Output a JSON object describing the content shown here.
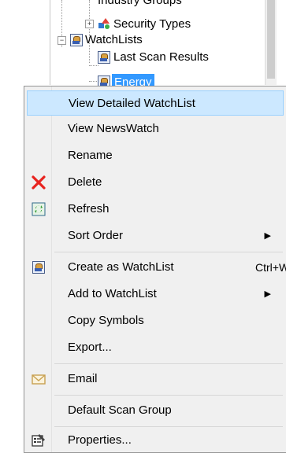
{
  "tree": {
    "items": [
      {
        "label": "Industry Groups"
      },
      {
        "label": "Security Types"
      },
      {
        "label": "WatchLists"
      },
      {
        "label": "Last Scan Results"
      },
      {
        "label": "Energy"
      }
    ]
  },
  "context_menu": {
    "items": [
      {
        "label": "View Detailed WatchList",
        "highlighted": true
      },
      {
        "label": "View NewsWatch"
      },
      {
        "label": "Rename"
      },
      {
        "label": "Delete",
        "icon": "delete-x-icon",
        "icon_color": "#e8231f"
      },
      {
        "label": "Refresh",
        "icon": "refresh-icon",
        "icon_color": "#2f9a2f"
      },
      {
        "label": "Sort Order",
        "submenu": true,
        "arrow": "▶"
      },
      {
        "label": "Create as WatchList",
        "icon": "watchlist-icon",
        "shortcut": "Ctrl+W"
      },
      {
        "label": "Add to WatchList",
        "submenu": true,
        "arrow": "▶"
      },
      {
        "label": "Copy Symbols"
      },
      {
        "label": "Export..."
      },
      {
        "label": "Email",
        "icon": "envelope-icon",
        "icon_color": "#c8a050"
      },
      {
        "label": "Default Scan Group"
      },
      {
        "label": "Properties...",
        "icon": "properties-icon"
      }
    ],
    "highlight_bg": "#cce8ff",
    "highlight_border": "#99d1ff"
  }
}
